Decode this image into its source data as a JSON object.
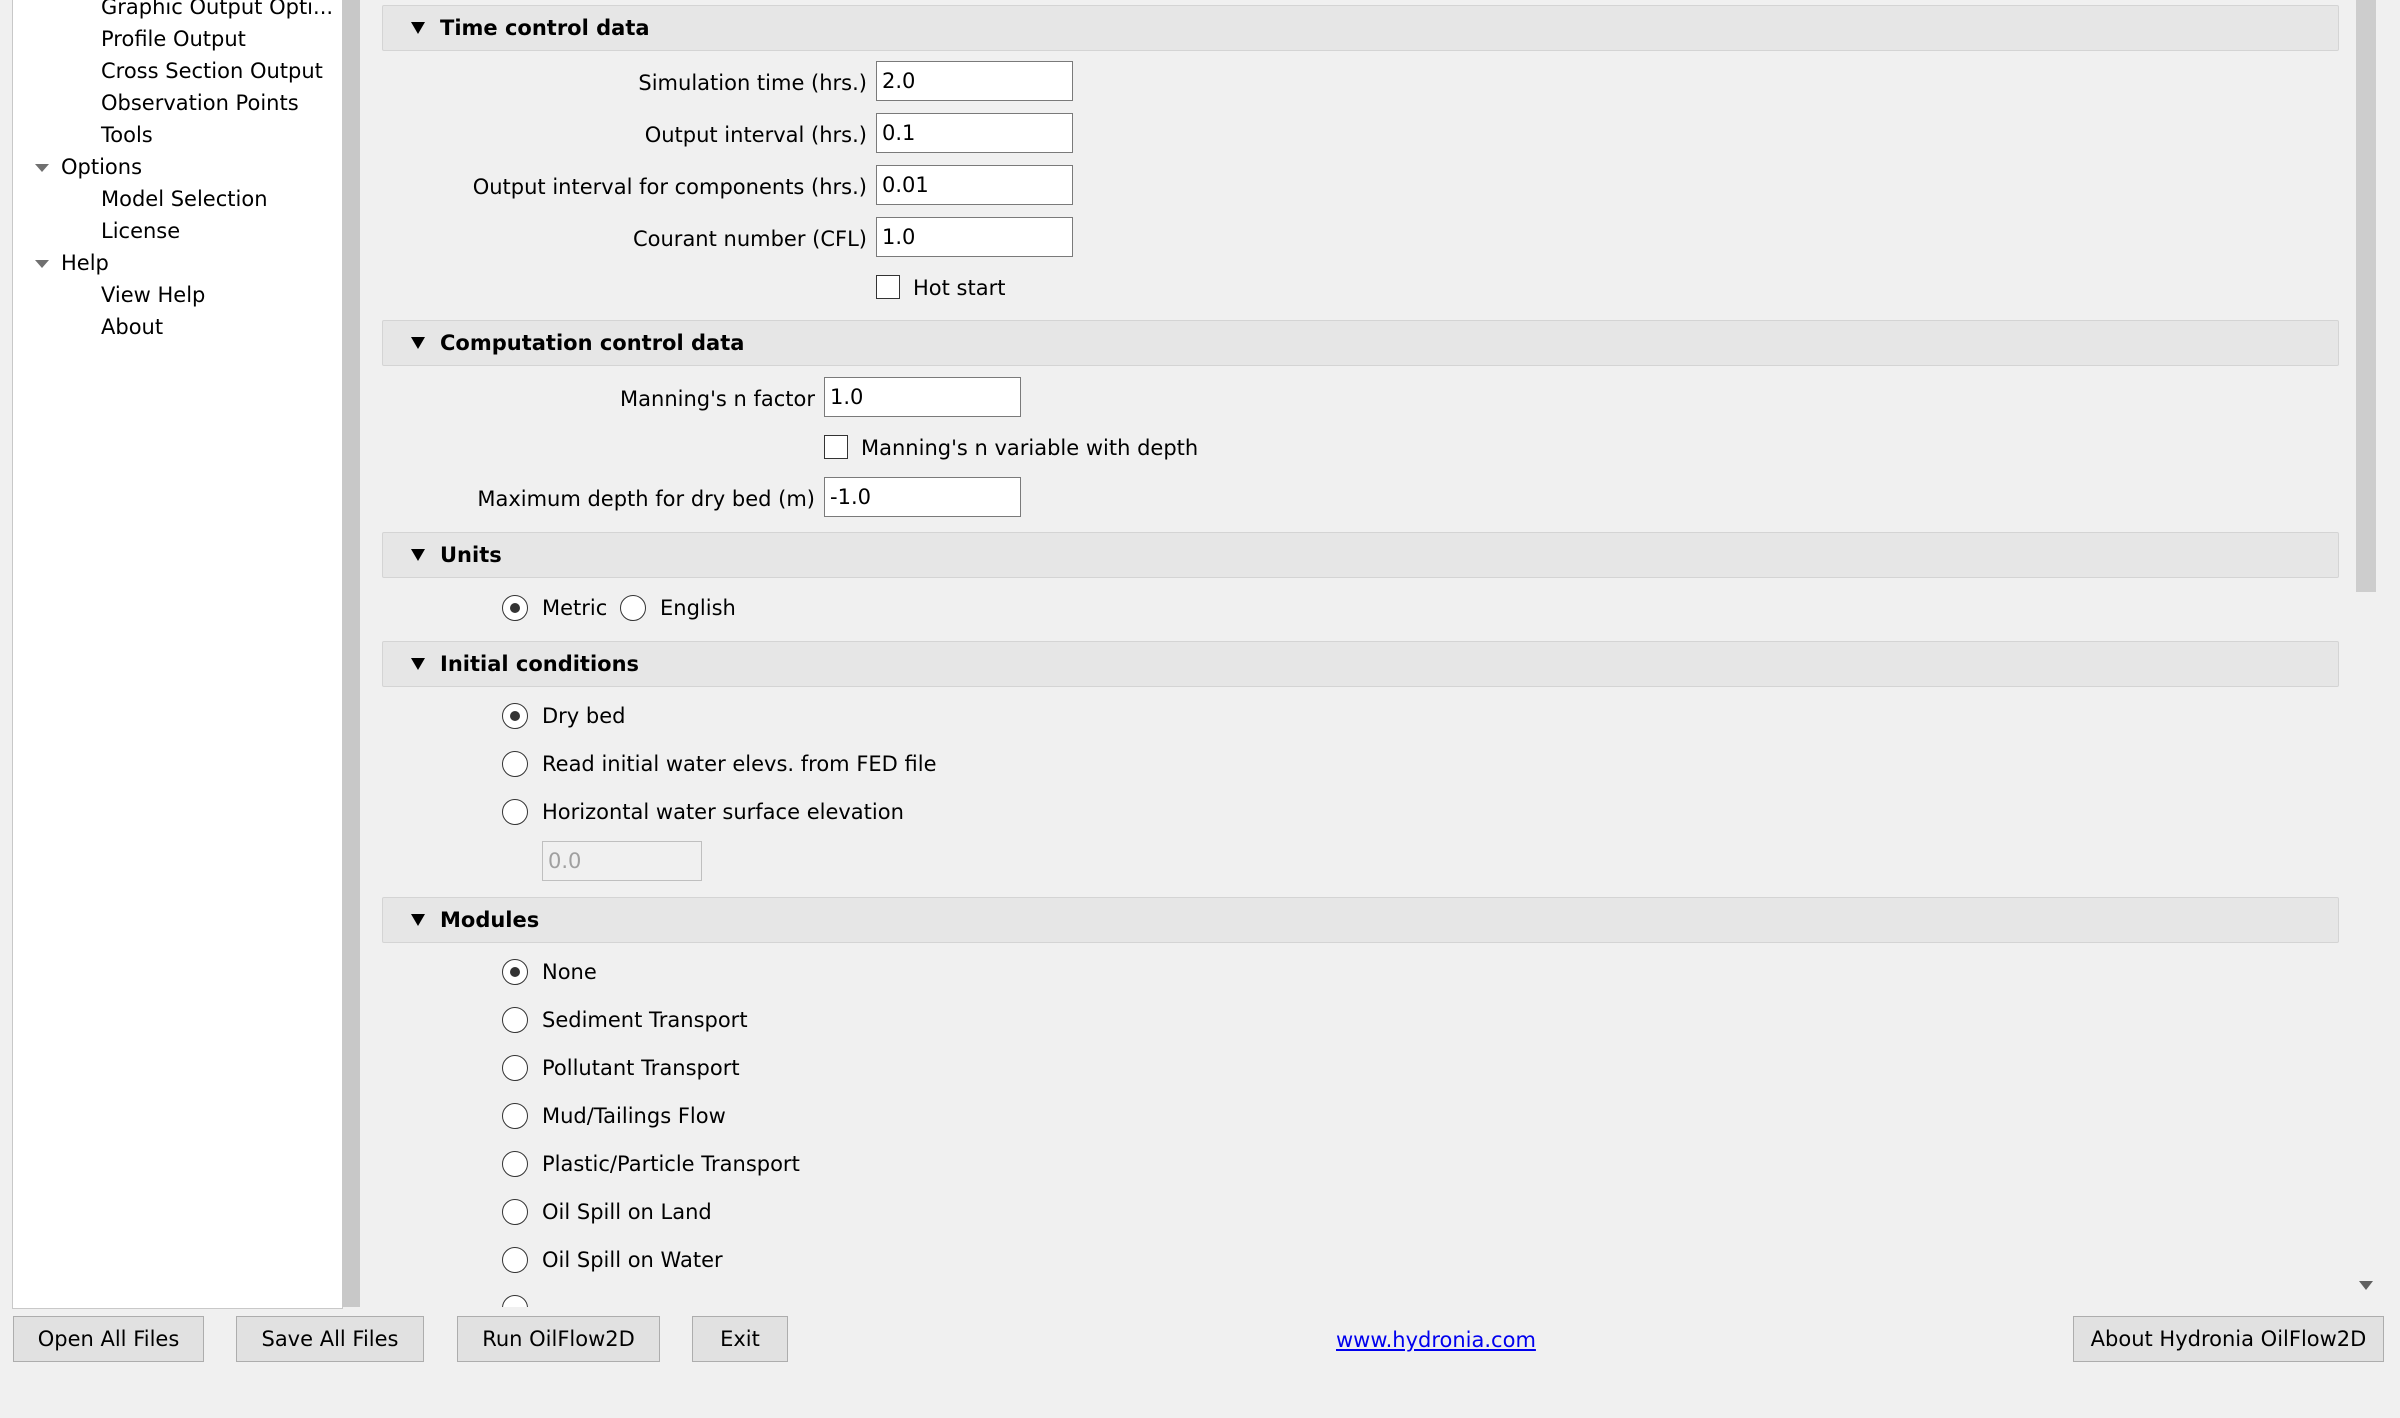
{
  "tree": {
    "items": [
      {
        "label": "Graphic Output Opti...",
        "level": 2
      },
      {
        "label": "Profile Output",
        "level": 2
      },
      {
        "label": "Cross Section Output",
        "level": 2
      },
      {
        "label": "Observation Points",
        "level": 2
      },
      {
        "label": "Tools",
        "level": 2
      },
      {
        "label": "Options",
        "level": 1
      },
      {
        "label": "Model Selection",
        "level": 2
      },
      {
        "label": "License",
        "level": 2
      },
      {
        "label": "Help",
        "level": 1
      },
      {
        "label": "View Help",
        "level": 2
      },
      {
        "label": "About",
        "level": 2
      }
    ]
  },
  "time_control": {
    "title": "Time control data",
    "simulation_time_label": "Simulation time (hrs.)",
    "simulation_time": "2.0",
    "output_interval_label": "Output interval (hrs.)",
    "output_interval": "0.1",
    "output_interval_components_label": "Output interval for components (hrs.)",
    "output_interval_components": "0.01",
    "courant_label": "Courant number (CFL)",
    "courant": "1.0",
    "hot_start_label": "Hot start",
    "hot_start": false
  },
  "computation_control": {
    "title": "Computation control data",
    "manning_label": "Manning's n factor",
    "manning": "1.0",
    "manning_variable_label": "Manning's n variable with depth",
    "manning_variable": false,
    "max_depth_label": "Maximum depth for dry bed (m)",
    "max_depth": "-1.0"
  },
  "units": {
    "title": "Units",
    "options": [
      "Metric",
      "English"
    ],
    "selected": "Metric"
  },
  "initial_conditions": {
    "title": "Initial conditions",
    "options": [
      "Dry bed",
      "Read initial water elevs. from FED file",
      "Horizontal water surface elevation"
    ],
    "selected": "Dry bed",
    "elevation_value": "0.0"
  },
  "modules": {
    "title": "Modules",
    "options": [
      "None",
      "Sediment Transport",
      "Pollutant Transport",
      "Mud/Tailings Flow",
      "Plastic/Particle Transport",
      "Oil Spill on Land",
      "Oil Spill on Water"
    ],
    "selected": "None"
  },
  "footer": {
    "open_all": "Open All Files",
    "save_all": "Save All Files",
    "run": "Run OilFlow2D",
    "exit": "Exit",
    "link": "www.hydronia.com",
    "about": "About Hydronia OilFlow2D"
  }
}
